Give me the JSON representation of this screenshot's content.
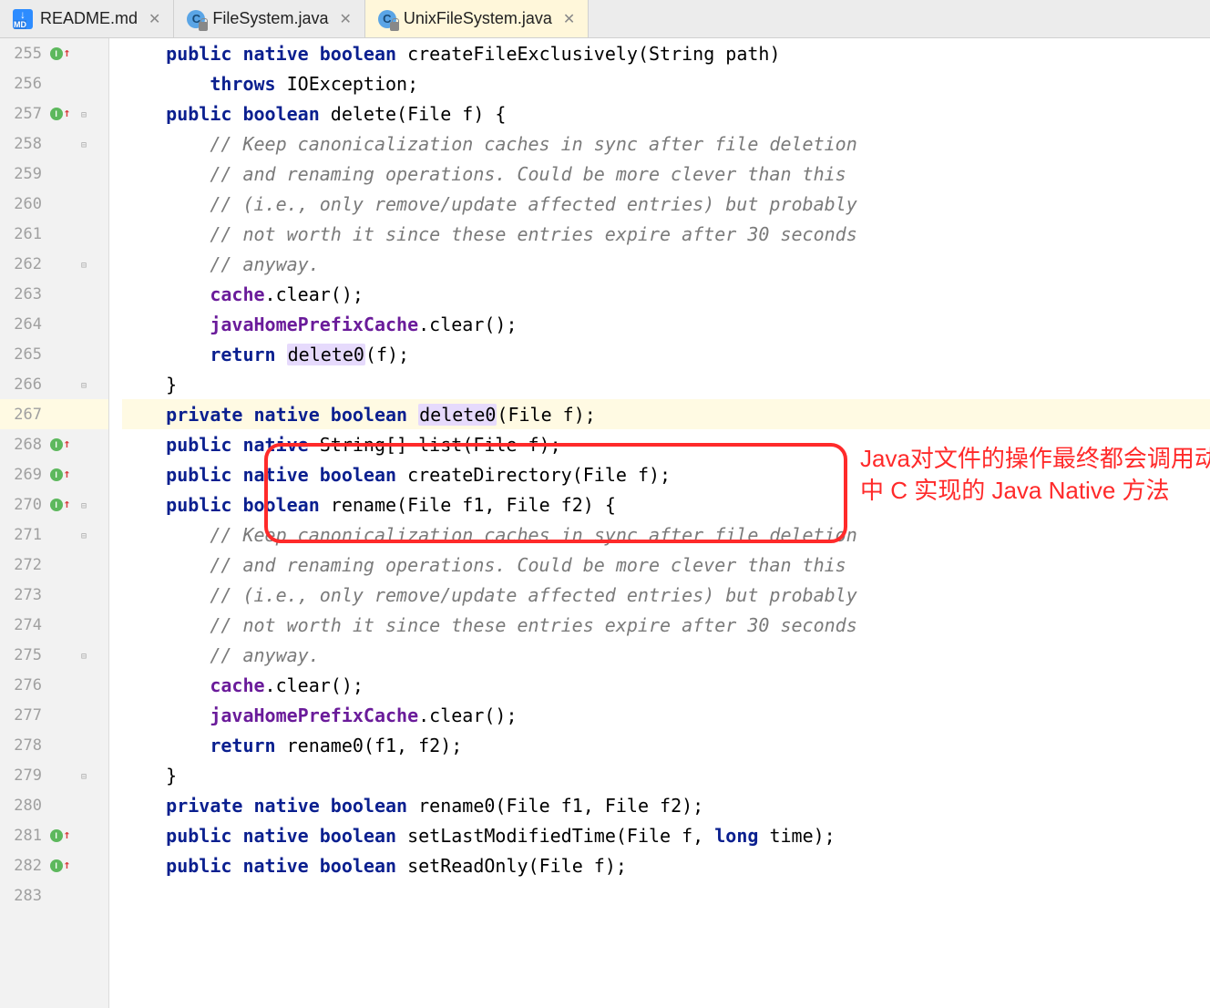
{
  "tabs": [
    {
      "label": "README.md",
      "type": "md",
      "active": false
    },
    {
      "label": "FileSystem.java",
      "type": "java",
      "active": false
    },
    {
      "label": "UnixFileSystem.java",
      "type": "java",
      "active": true
    }
  ],
  "annotation": "Java对文件的操作最终都会调用动态链接库中 C 实现的 Java Native 方法",
  "code_lines": [
    {
      "num": 255,
      "marker": "impl",
      "fold": "",
      "hl": false,
      "tokens": [
        [
          "    ",
          ""
        ],
        [
          "public native boolean",
          "kw"
        ],
        [
          " createFileExclusively(String path)",
          "id"
        ]
      ]
    },
    {
      "num": 256,
      "marker": "",
      "fold": "",
      "hl": false,
      "tokens": [
        [
          "        ",
          ""
        ],
        [
          "throws",
          "kw"
        ],
        [
          " IOException;",
          "id"
        ]
      ]
    },
    {
      "num": 257,
      "marker": "impl",
      "fold": "open",
      "hl": false,
      "tokens": [
        [
          "    ",
          ""
        ],
        [
          "public boolean",
          "kw"
        ],
        [
          " delete(File f) {",
          "id"
        ]
      ]
    },
    {
      "num": 258,
      "marker": "",
      "fold": "open",
      "hl": false,
      "tokens": [
        [
          "        ",
          ""
        ],
        [
          "// Keep canonicalization caches in sync after file deletion",
          "cm"
        ]
      ]
    },
    {
      "num": 259,
      "marker": "",
      "fold": "",
      "hl": false,
      "tokens": [
        [
          "        ",
          ""
        ],
        [
          "// and renaming operations. Could be more clever than this",
          "cm"
        ]
      ]
    },
    {
      "num": 260,
      "marker": "",
      "fold": "",
      "hl": false,
      "tokens": [
        [
          "        ",
          ""
        ],
        [
          "// (i.e., only remove/update affected entries) but probably",
          "cm"
        ]
      ]
    },
    {
      "num": 261,
      "marker": "",
      "fold": "",
      "hl": false,
      "tokens": [
        [
          "        ",
          ""
        ],
        [
          "// not worth it since these entries expire after 30 seconds",
          "cm"
        ]
      ]
    },
    {
      "num": 262,
      "marker": "",
      "fold": "close",
      "hl": false,
      "tokens": [
        [
          "        ",
          ""
        ],
        [
          "// anyway.",
          "cm"
        ]
      ]
    },
    {
      "num": 263,
      "marker": "",
      "fold": "",
      "hl": false,
      "tokens": [
        [
          "        ",
          ""
        ],
        [
          "cache",
          "fld"
        ],
        [
          ".clear();",
          "id"
        ]
      ]
    },
    {
      "num": 264,
      "marker": "",
      "fold": "",
      "hl": false,
      "tokens": [
        [
          "        ",
          ""
        ],
        [
          "javaHomePrefixCache",
          "fld"
        ],
        [
          ".clear();",
          "id"
        ]
      ]
    },
    {
      "num": 265,
      "marker": "",
      "fold": "",
      "hl": false,
      "tokens": [
        [
          "        ",
          ""
        ],
        [
          "return",
          "kw"
        ],
        [
          " ",
          "id"
        ],
        [
          "delete0",
          "hl-usage"
        ],
        [
          "(f);",
          "id"
        ]
      ]
    },
    {
      "num": 266,
      "marker": "",
      "fold": "close",
      "hl": false,
      "tokens": [
        [
          "    }",
          "id"
        ]
      ]
    },
    {
      "num": 267,
      "marker": "",
      "fold": "",
      "hl": true,
      "tokens": [
        [
          "    ",
          ""
        ],
        [
          "private native boolean",
          "kw"
        ],
        [
          " ",
          "id"
        ],
        [
          "delete0",
          "hl-usage"
        ],
        [
          "(File f);",
          "id"
        ]
      ]
    },
    {
      "num": 268,
      "marker": "impl",
      "fold": "",
      "hl": false,
      "tokens": [
        [
          "    ",
          ""
        ],
        [
          "public native",
          "kw"
        ],
        [
          " String[] list(File f);",
          "id"
        ]
      ]
    },
    {
      "num": 269,
      "marker": "impl",
      "fold": "",
      "hl": false,
      "tokens": [
        [
          "    ",
          ""
        ],
        [
          "public native boolean",
          "kw"
        ],
        [
          " createDirectory(File f);",
          "id"
        ]
      ]
    },
    {
      "num": 270,
      "marker": "impl",
      "fold": "open",
      "hl": false,
      "tokens": [
        [
          "    ",
          ""
        ],
        [
          "public boolean",
          "kw"
        ],
        [
          " rename(File f1, File f2) {",
          "id"
        ]
      ]
    },
    {
      "num": 271,
      "marker": "",
      "fold": "open",
      "hl": false,
      "tokens": [
        [
          "        ",
          ""
        ],
        [
          "// Keep canonicalization caches in sync after file deletion",
          "cm"
        ]
      ]
    },
    {
      "num": 272,
      "marker": "",
      "fold": "",
      "hl": false,
      "tokens": [
        [
          "        ",
          ""
        ],
        [
          "// and renaming operations. Could be more clever than this",
          "cm"
        ]
      ]
    },
    {
      "num": 273,
      "marker": "",
      "fold": "",
      "hl": false,
      "tokens": [
        [
          "        ",
          ""
        ],
        [
          "// (i.e., only remove/update affected entries) but probably",
          "cm"
        ]
      ]
    },
    {
      "num": 274,
      "marker": "",
      "fold": "",
      "hl": false,
      "tokens": [
        [
          "        ",
          ""
        ],
        [
          "// not worth it since these entries expire after 30 seconds",
          "cm"
        ]
      ]
    },
    {
      "num": 275,
      "marker": "",
      "fold": "close",
      "hl": false,
      "tokens": [
        [
          "        ",
          ""
        ],
        [
          "// anyway.",
          "cm"
        ]
      ]
    },
    {
      "num": 276,
      "marker": "",
      "fold": "",
      "hl": false,
      "tokens": [
        [
          "        ",
          ""
        ],
        [
          "cache",
          "fld"
        ],
        [
          ".clear();",
          "id"
        ]
      ]
    },
    {
      "num": 277,
      "marker": "",
      "fold": "",
      "hl": false,
      "tokens": [
        [
          "        ",
          ""
        ],
        [
          "javaHomePrefixCache",
          "fld"
        ],
        [
          ".clear();",
          "id"
        ]
      ]
    },
    {
      "num": 278,
      "marker": "",
      "fold": "",
      "hl": false,
      "tokens": [
        [
          "        ",
          ""
        ],
        [
          "return",
          "kw"
        ],
        [
          " rename0(f1, f2);",
          "id"
        ]
      ]
    },
    {
      "num": 279,
      "marker": "",
      "fold": "close",
      "hl": false,
      "tokens": [
        [
          "    }",
          "id"
        ]
      ]
    },
    {
      "num": 280,
      "marker": "",
      "fold": "",
      "hl": false,
      "tokens": [
        [
          "    ",
          ""
        ],
        [
          "private native boolean",
          "kw"
        ],
        [
          " rename0(File f1, File f2);",
          "id"
        ]
      ]
    },
    {
      "num": 281,
      "marker": "impl",
      "fold": "",
      "hl": false,
      "tokens": [
        [
          "    ",
          ""
        ],
        [
          "public native boolean",
          "kw"
        ],
        [
          " setLastModifiedTime(File f, ",
          "id"
        ],
        [
          "long",
          "kw"
        ],
        [
          " time);",
          "id"
        ]
      ]
    },
    {
      "num": 282,
      "marker": "impl",
      "fold": "",
      "hl": false,
      "tokens": [
        [
          "    ",
          ""
        ],
        [
          "public native boolean",
          "kw"
        ],
        [
          " setReadOnly(File f);",
          "id"
        ]
      ]
    },
    {
      "num": 283,
      "marker": "",
      "fold": "",
      "hl": false,
      "tokens": [
        [
          "",
          ""
        ]
      ]
    }
  ]
}
